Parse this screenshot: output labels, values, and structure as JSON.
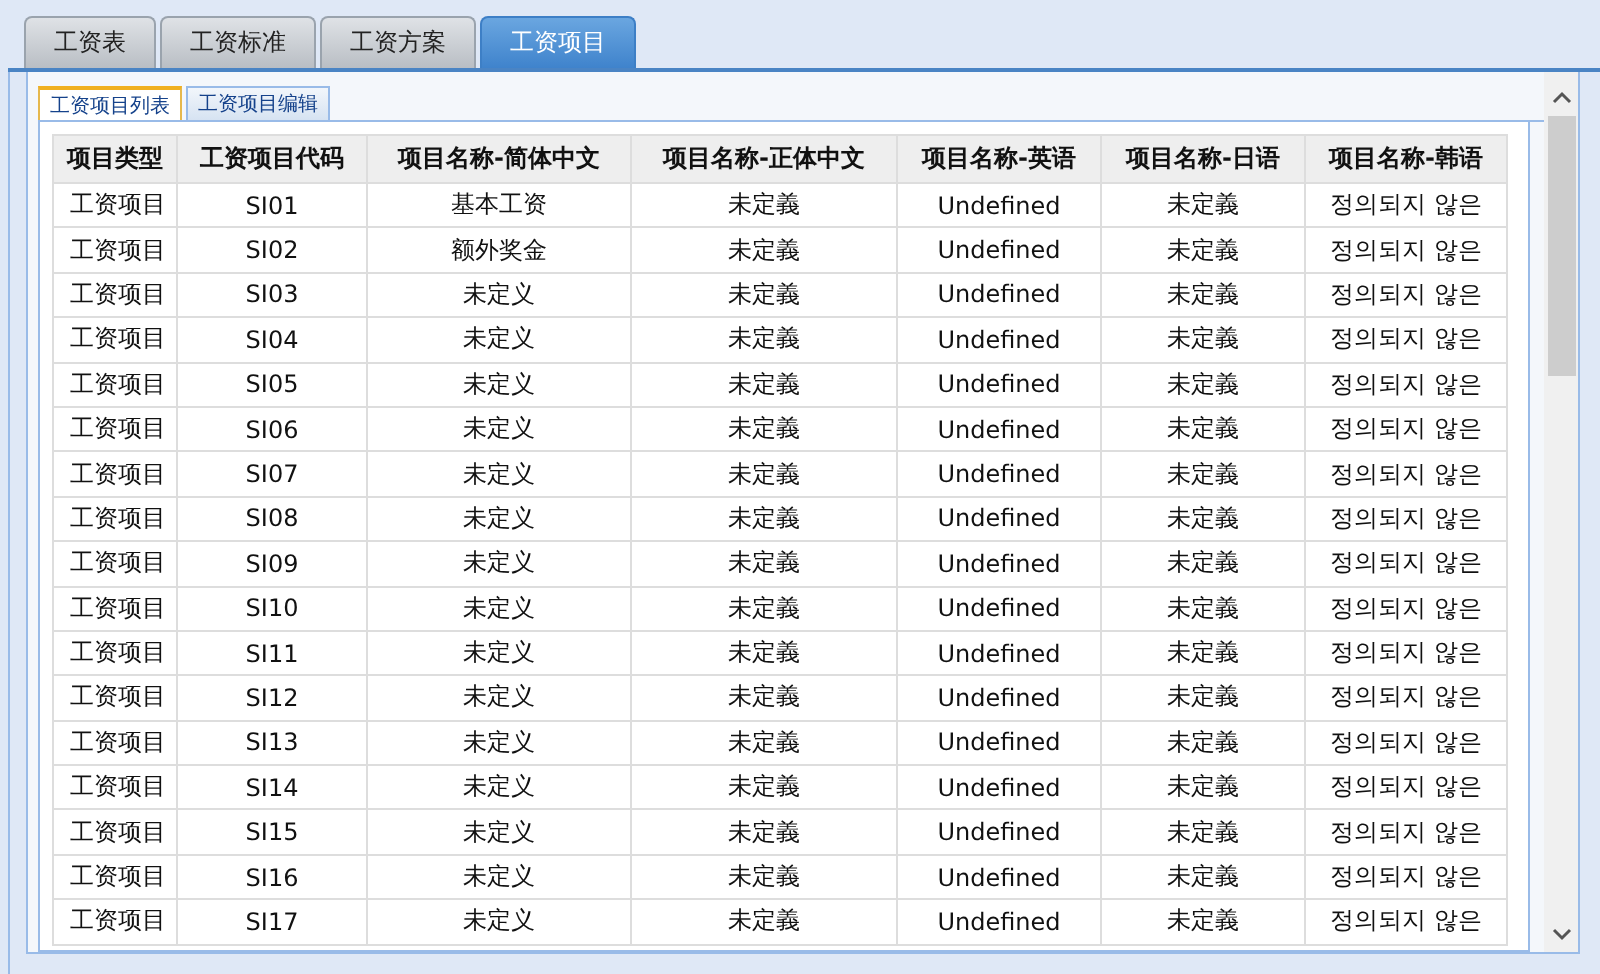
{
  "tabs": [
    {
      "label": "工资表",
      "selected": false
    },
    {
      "label": "工资标准",
      "selected": false
    },
    {
      "label": "工资方案",
      "selected": false
    },
    {
      "label": "工资项目",
      "selected": true
    }
  ],
  "subtabs": [
    {
      "label": "工资项目列表",
      "selected": true
    },
    {
      "label": "工资项目编辑",
      "selected": false
    }
  ],
  "table": {
    "columns": [
      "项目类型",
      "工资项目代码",
      "项目名称-简体中文",
      "项目名称-正体中文",
      "项目名称-英语",
      "项目名称-日语",
      "项目名称-韩语"
    ],
    "rows": [
      [
        "工资项目",
        "SI01",
        "基本工资",
        "未定義",
        "Undefined",
        "未定義",
        "정의되지 않은"
      ],
      [
        "工资项目",
        "SI02",
        "额外奖金",
        "未定義",
        "Undefined",
        "未定義",
        "정의되지 않은"
      ],
      [
        "工资项目",
        "SI03",
        "未定义",
        "未定義",
        "Undefined",
        "未定義",
        "정의되지 않은"
      ],
      [
        "工资项目",
        "SI04",
        "未定义",
        "未定義",
        "Undefined",
        "未定義",
        "정의되지 않은"
      ],
      [
        "工资项目",
        "SI05",
        "未定义",
        "未定義",
        "Undefined",
        "未定義",
        "정의되지 않은"
      ],
      [
        "工资项目",
        "SI06",
        "未定义",
        "未定義",
        "Undefined",
        "未定義",
        "정의되지 않은"
      ],
      [
        "工资项目",
        "SI07",
        "未定义",
        "未定義",
        "Undefined",
        "未定義",
        "정의되지 않은"
      ],
      [
        "工资项目",
        "SI08",
        "未定义",
        "未定義",
        "Undefined",
        "未定義",
        "정의되지 않은"
      ],
      [
        "工资项目",
        "SI09",
        "未定义",
        "未定義",
        "Undefined",
        "未定義",
        "정의되지 않은"
      ],
      [
        "工资项目",
        "SI10",
        "未定义",
        "未定義",
        "Undefined",
        "未定義",
        "정의되지 않은"
      ],
      [
        "工资项目",
        "SI11",
        "未定义",
        "未定義",
        "Undefined",
        "未定義",
        "정의되지 않은"
      ],
      [
        "工资项目",
        "SI12",
        "未定义",
        "未定義",
        "Undefined",
        "未定義",
        "정의되지 않은"
      ],
      [
        "工资项目",
        "SI13",
        "未定义",
        "未定義",
        "Undefined",
        "未定義",
        "정의되지 않은"
      ],
      [
        "工资项目",
        "SI14",
        "未定义",
        "未定義",
        "Undefined",
        "未定義",
        "정의되지 않은"
      ],
      [
        "工资项目",
        "SI15",
        "未定义",
        "未定義",
        "Undefined",
        "未定義",
        "정의되지 않은"
      ],
      [
        "工资项目",
        "SI16",
        "未定义",
        "未定義",
        "Undefined",
        "未定義",
        "정의되지 않은"
      ],
      [
        "工资项目",
        "SI17",
        "未定义",
        "未定義",
        "Undefined",
        "未定義",
        "정의되지 않은"
      ]
    ]
  }
}
